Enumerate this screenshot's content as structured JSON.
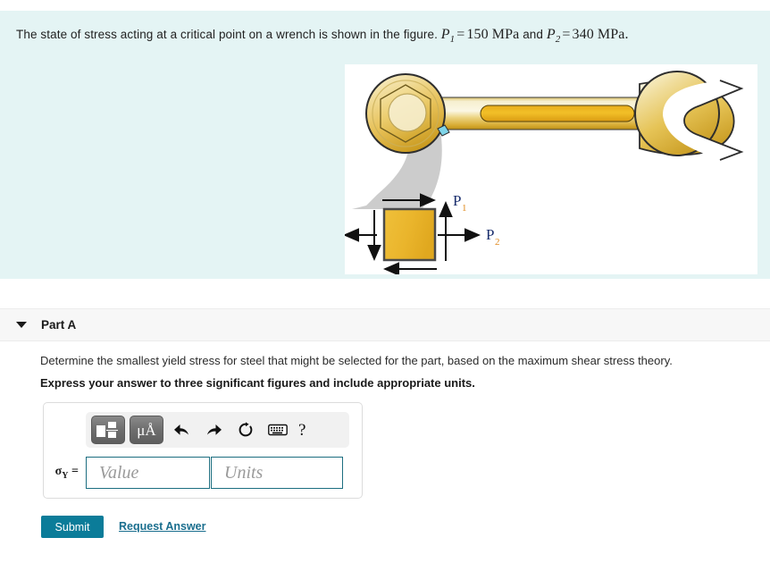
{
  "problem": {
    "text_before": "The state of stress acting at a critical point on a wrench is shown in the figure.",
    "var1": "P",
    "var1_sub": "1",
    "eq1": "=",
    "val1": "150 MPa",
    "conjunction": "and",
    "var2": "P",
    "var2_sub": "2",
    "eq2": "=",
    "val2": "340 MPa",
    "period": "."
  },
  "figure": {
    "label_p1": "P",
    "label_p1_sub": "1",
    "label_p2": "P",
    "label_p2_sub": "2",
    "colors": {
      "panel_bg": "#e4f4f4",
      "figure_bg": "#ffffff",
      "wrench_gold": "#e8b93a",
      "wrench_light": "#f7eec8",
      "element_fill": "#e8b32e",
      "element_stroke": "#4a4a4a",
      "connector_gray": "#c9c9c9",
      "label_blue": "#1b2f6e",
      "label_sub_orange": "#e08a1e"
    }
  },
  "part": {
    "title": "Part A",
    "caret": "caret-down-icon",
    "question": "Determine the smallest yield stress for steel that might be selected for the part, based on the maximum shear stress theory.",
    "instruction": "Express your answer to three significant figures and include appropriate units."
  },
  "toolbar": {
    "template_button": "math-template-icon",
    "units_button": "μÅ",
    "undo": "undo-arrow-icon",
    "redo": "redo-arrow-icon",
    "reset": "reset-circle-icon",
    "keyboard": "keyboard-icon",
    "help": "?"
  },
  "answer": {
    "label_sigma": "σ",
    "label_sub": "Y",
    "label_equals": "=",
    "value_placeholder": "Value",
    "units_placeholder": "Units",
    "value_current": "",
    "units_current": ""
  },
  "actions": {
    "submit_label": "Submit",
    "request_answer_label": "Request Answer",
    "submit_color": "#0b7c99",
    "link_color": "#1a6e8e"
  }
}
